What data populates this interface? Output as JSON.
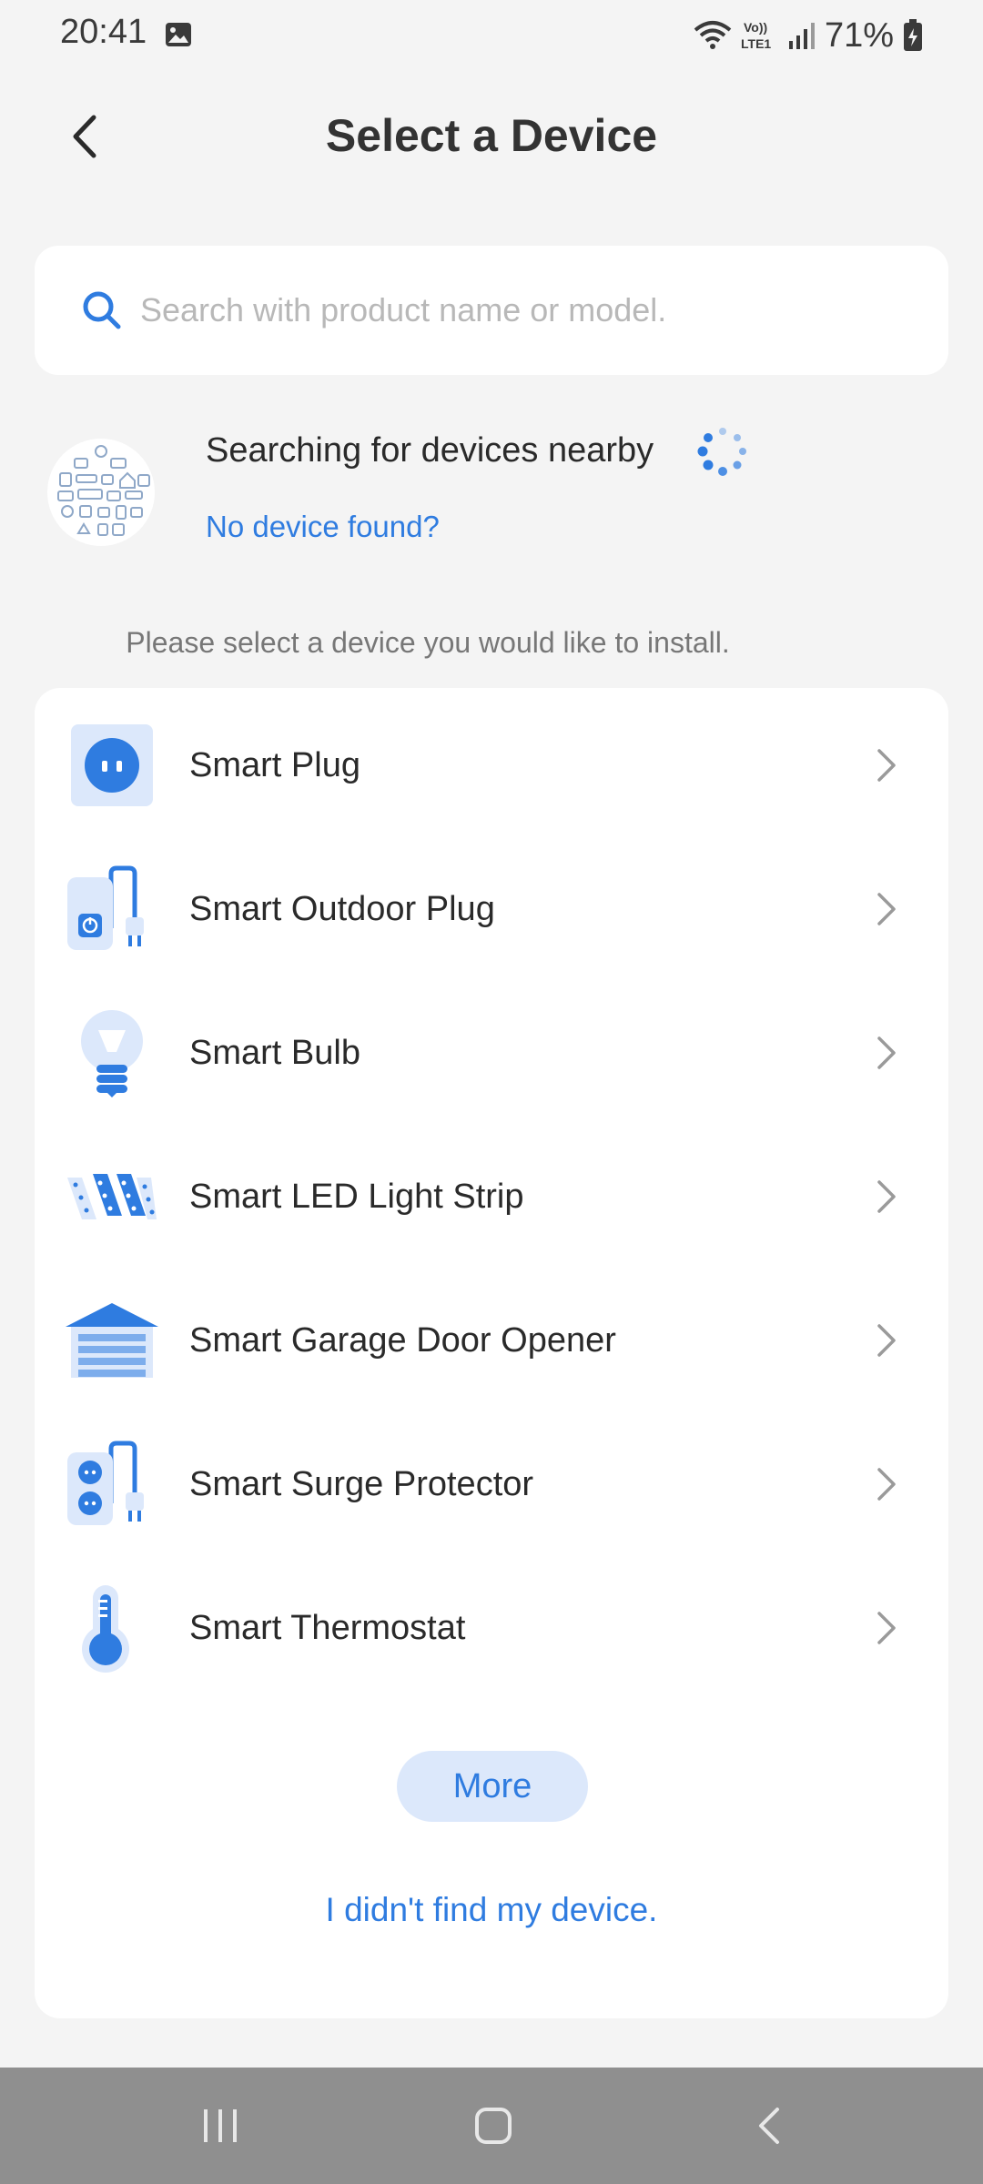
{
  "status_bar": {
    "time": "20:41",
    "battery_percent": "71%",
    "icons": [
      "gallery-icon",
      "wifi-icon",
      "volte-icon",
      "signal-icon",
      "battery-icon"
    ]
  },
  "header": {
    "title": "Select a Device",
    "back_icon": "chevron-left-icon"
  },
  "search": {
    "placeholder": "Search with product name or model."
  },
  "nearby": {
    "status_text": "Searching for devices nearby",
    "no_device_link": "No device found?"
  },
  "hint": "Please select a device you would like to install.",
  "devices": [
    {
      "label": "Smart Plug",
      "icon": "smart-plug-icon"
    },
    {
      "label": "Smart Outdoor Plug",
      "icon": "outdoor-plug-icon"
    },
    {
      "label": "Smart Bulb",
      "icon": "bulb-icon"
    },
    {
      "label": "Smart LED Light Strip",
      "icon": "light-strip-icon"
    },
    {
      "label": "Smart Garage Door Opener",
      "icon": "garage-door-icon"
    },
    {
      "label": "Smart Surge Protector",
      "icon": "surge-protector-icon"
    },
    {
      "label": "Smart Thermostat",
      "icon": "thermostat-icon"
    }
  ],
  "more_button": "More",
  "not_found_link": "I didn't find my device.",
  "colors": {
    "accent": "#2f7ce0",
    "accent_light": "#dce8fb",
    "background": "#f4f4f4",
    "nav_bar": "#8f8f8f"
  }
}
